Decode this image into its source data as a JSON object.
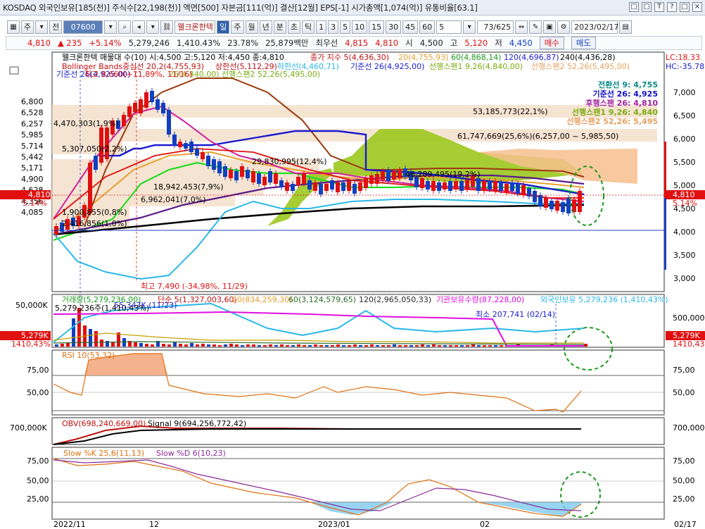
{
  "titlebar": {
    "text": "KOSDAQ 외국인보유[185(천)] 주식수[22,198(천)] 액면[500] 자본금[111(억)] 결산[12월] EPS[-1] 시가총액[1,074(억)] 유통비율[63.1]",
    "buttons": [
      "□",
      "□",
      "T",
      "?",
      "□",
      "×"
    ]
  },
  "toolbar": {
    "period": "주",
    "prev": "전",
    "code": "07600",
    "name": "웰크론한텍",
    "intervals": [
      "일",
      "주",
      "월",
      "년",
      "분",
      "초",
      "틱"
    ],
    "nums": [
      "1",
      "3",
      "5",
      "10",
      "15",
      "30",
      "45",
      "60"
    ],
    "count_sel": "5",
    "page": "73/625",
    "date": "2023/02/17",
    "buy": "매수",
    "sell": "매도"
  },
  "quote": {
    "price": "4,810",
    "change": "▲ 235",
    "rate": "+5.14%",
    "volume": "5,279,246",
    "vol_ratio": "1,410.43%",
    "turnover": "23.78%",
    "amount": "25,879백만",
    "best_sell": "최우선",
    "best_sell_val": "4,815",
    "best_buy_val": "4,810",
    "open_l": "시",
    "open": "4,500",
    "high_l": "고",
    "high": "5,120",
    "low_l": "저",
    "low": "4,450"
  },
  "main": {
    "legend1": "웰크론한텍 매물대 수(10)  시:4,500 고:5,120 저:4,450 종:4,810",
    "legend_ma": "종가 지수 5(4,636,30)",
    "legend_ma20": "20(4,755,93)",
    "legend_ma60": "60(4,868,14)",
    "legend_ma120": "120(4,696,87)",
    "legend_ma240": "240(4,436,28)",
    "legend_bb": "Bollinger Bands중심선 20,2(4,755,93)",
    "legend_bb_up": "상한선(5,112,29)",
    "legend_bb_dn": "하한선(4,460,71)",
    "legend_kijun": "기준선 26(4,925,00)",
    "legend_span1": "선행스팬1 9,26(4,840,00)",
    "legend_span2": "선행스팬2 52,26(5,495,00)",
    "legend_ichi_l": "기준선 26(4,925,00)",
    "legend_ichi_l2": "26(4,840,00)  선행스팬2 52,26(5,495,00)",
    "right_top1": "LC:18.33",
    "right_top2": "HC:-35.78",
    "ichi_box": [
      {
        "label": "전환선 9:",
        "val": "4,755",
        "color": "#0a8a8a"
      },
      {
        "label": "기준선 26:",
        "val": "4,925",
        "color": "#1010c8"
      },
      {
        "label": "후행스팬 26:",
        "val": "4,810",
        "color": "#a020a0"
      },
      {
        "label": "선행스팬1 9,26:",
        "val": "4,840",
        "color": "#7aaa10"
      },
      {
        "label": "선행스팬2 52,26:",
        "val": "5,495",
        "color": "#e8a060"
      }
    ],
    "ann": {
      "vp1": "53,185,773(22,1%)",
      "vp2": "61,747,669(25,6%)(6,257,00 ~ 5,985,50)",
      "vp3": "4,470,303(1,9%)",
      "vp4": "5,307,050(2,2%)",
      "vp5": "29,830,995(12,4%)",
      "vp6": "46,289,495(19,2%)",
      "vp7": "18,942,453(7,9%)",
      "vp8": "6,962,041(7,0%)",
      "vp9": "1,900,855(0,8%)",
      "vp10": "2,416,856(1,0%)",
      "high": "최고 8,660(+11,89%, 11/16)",
      "low": "최고 7,490 (-34,98%, 11/29)"
    },
    "yticks_left": [
      "6,800",
      "6,528",
      "6,257",
      "5,985",
      "5,714",
      "5,442",
      "5,171",
      "4,900",
      "4,628",
      "4,356",
      "4,085"
    ],
    "yticks_right": [
      "7,000",
      "6,500",
      "6,000",
      "5,500",
      "5,000",
      "4,500",
      "4,000",
      "3,500",
      "3,000"
    ],
    "price_tag": "4,810",
    "rate_tag": "5.14%"
  },
  "volume": {
    "legend": "거래량(5,279,236,00)",
    "legend_ma5": "단순 5(1,327,003,60)",
    "legend_ma20": "20(834,259,30)",
    "legend_ma60": "60(3,124,579,65)",
    "legend_ma120": "120(2,965,050,33)",
    "legend_inst": "기관보유수량(87,228,00)",
    "legend_frgn": "외국인보유 5,279,236 (1,410,43%)",
    "ann_max": "5,279,236주(1,410,43%)",
    "ann_max2": "55,347K (11/23)",
    "ann_min": "최소 207,741 (02/14)",
    "yleft": "50,000K",
    "yright": "500,000",
    "tag_vol": "5,279K",
    "tag_rate": "1410,43%"
  },
  "rsi": {
    "legend": "RSI 10(53,32)",
    "ticks": [
      "75,00",
      "50,00"
    ]
  },
  "obv": {
    "legend": "OBV(698,240,669,00)",
    "legend_sig": "Signal 9(694,256,772,42)",
    "tick": "700,000K"
  },
  "stoch": {
    "legend_k": "Slow %K 25,6(11,13)",
    "legend_d": "Slow %D 6(10,23)",
    "ticks": [
      "75,00",
      "50,00",
      "25,00"
    ]
  },
  "xaxis": [
    "2022/11",
    "12",
    "2023/01",
    "02",
    "02/17"
  ]
}
